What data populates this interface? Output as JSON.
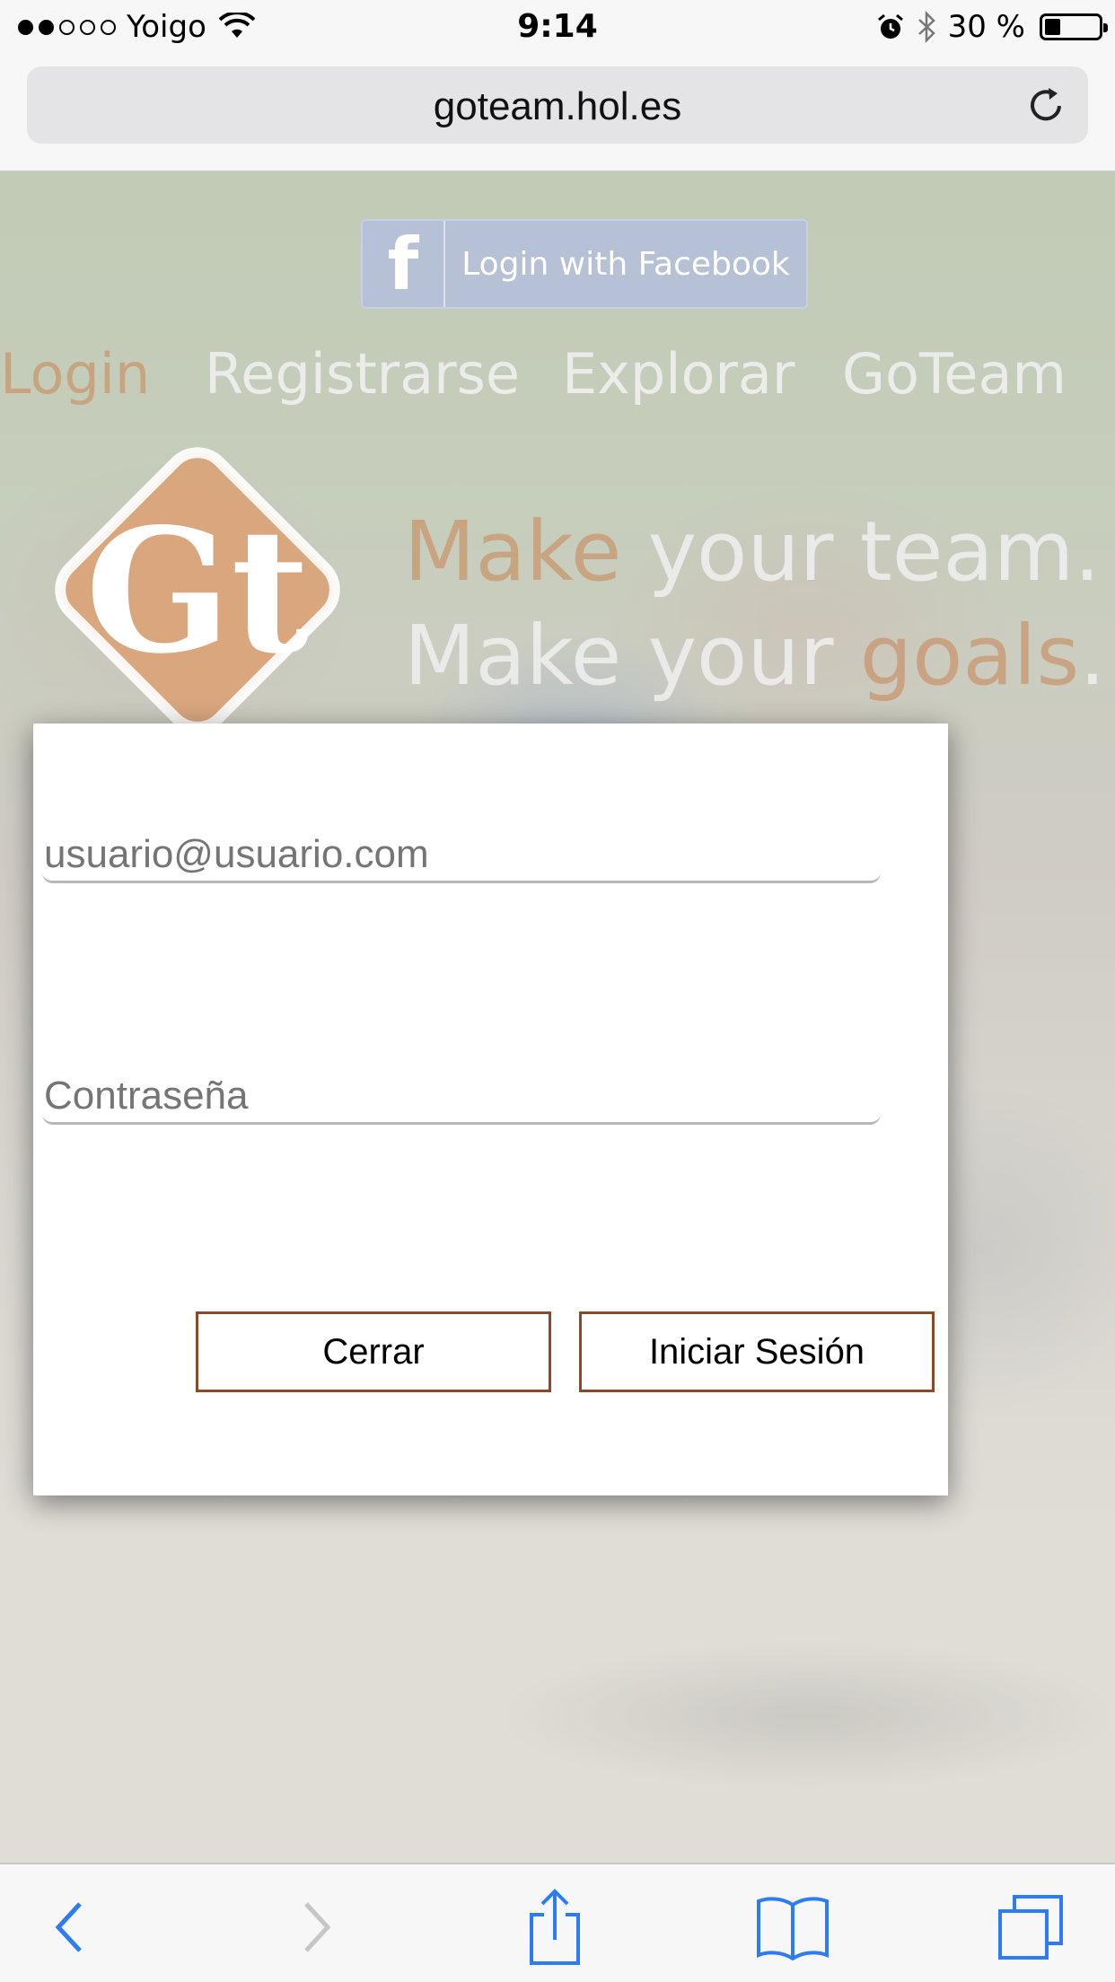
{
  "status_bar": {
    "carrier": "Yoigo",
    "time": "9:14",
    "battery_percent": "30 %",
    "battery_level": 0.3,
    "signal_bars": 2,
    "icons": [
      "wifi-icon",
      "alarm-icon",
      "bluetooth-icon",
      "battery-icon"
    ]
  },
  "browser": {
    "url": "goteam.hol.es",
    "toolbar_icons": [
      "back-icon",
      "forward-icon",
      "share-icon",
      "bookmarks-icon",
      "tabs-icon"
    ]
  },
  "page": {
    "facebook_button": {
      "icon": "f",
      "label": "Login with Facebook"
    },
    "nav": [
      {
        "label": "Login",
        "active": true
      },
      {
        "label": "Registrarse",
        "active": false
      },
      {
        "label": "Explorar",
        "active": false
      },
      {
        "label": "GoTeam",
        "active": false
      }
    ],
    "logo_text": "Gt",
    "tagline": {
      "line1_accent": "Make",
      "line1_rest": " your team.",
      "line2_start": "Make your ",
      "line2_accent": "goals",
      "line2_end": "."
    },
    "accent_color": "#c8966e"
  },
  "modal": {
    "email_placeholder": "usuario@usuario.com",
    "password_placeholder": "Contraseña",
    "close_label": "Cerrar",
    "submit_label": "Iniciar Sesión",
    "button_border_color": "#8b4a26"
  }
}
